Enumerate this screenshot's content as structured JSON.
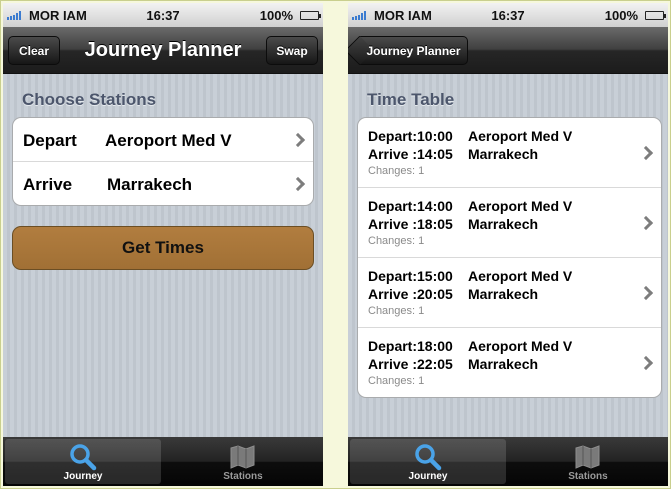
{
  "status": {
    "carrier": "MOR IAM",
    "time": "16:37",
    "battery": "100%"
  },
  "planner": {
    "title": "Journey Planner",
    "clear_label": "Clear",
    "swap_label": "Swap",
    "section_title": "Choose Stations",
    "depart_label": "Depart",
    "depart_value": "Aeroport Med V",
    "arrive_label": "Arrive",
    "arrive_value": "Marrakech",
    "get_times_label": "Get Times"
  },
  "timetable": {
    "back_label": "Journey Planner",
    "section_title": "Time Table",
    "trips": [
      {
        "depart": "Depart:10:00",
        "from": "Aeroport Med V",
        "arrive": "Arrive :14:05",
        "to": "Marrakech",
        "changes": "Changes: 1"
      },
      {
        "depart": "Depart:14:00",
        "from": "Aeroport Med V",
        "arrive": "Arrive :18:05",
        "to": "Marrakech",
        "changes": "Changes: 1"
      },
      {
        "depart": "Depart:15:00",
        "from": "Aeroport Med V",
        "arrive": "Arrive :20:05",
        "to": "Marrakech",
        "changes": "Changes: 1"
      },
      {
        "depart": "Depart:18:00",
        "from": "Aeroport Med V",
        "arrive": "Arrive :22:05",
        "to": "Marrakech",
        "changes": "Changes: 1"
      }
    ]
  },
  "tabs": [
    {
      "label": "Journey",
      "icon": "magnifier-icon",
      "active": true
    },
    {
      "label": "Stations",
      "icon": "map-icon",
      "active": false
    }
  ],
  "colors": {
    "accent_button": "#a97639",
    "tab_icon_active": "#4aa3e8"
  }
}
